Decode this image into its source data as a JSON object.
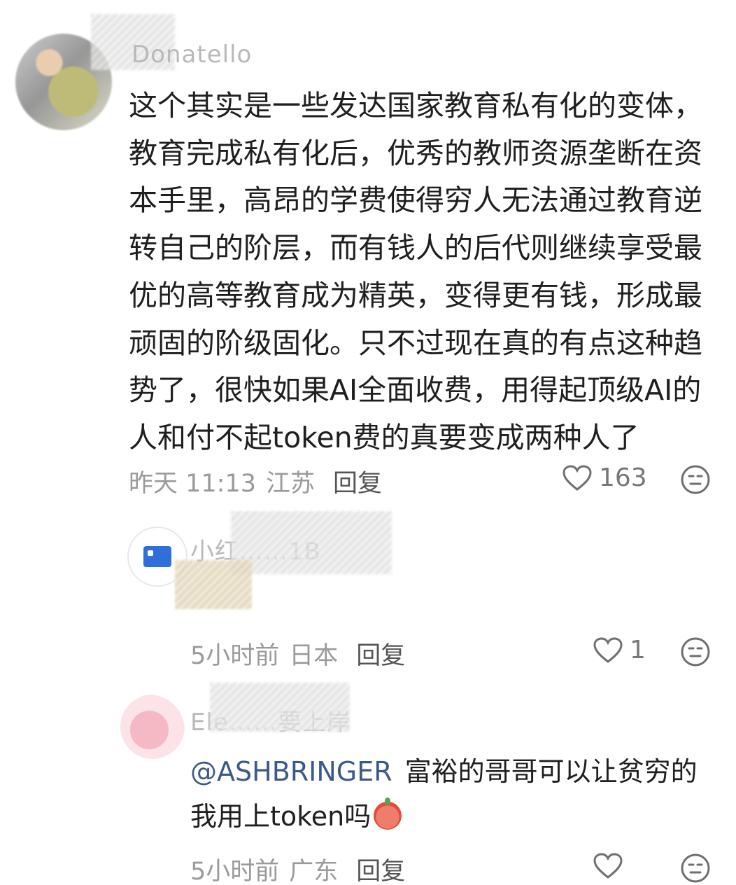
{
  "comment": {
    "username": "Donatello",
    "text_lines": [
      "这个其实是一些发达国家教育私有化的变体，",
      "教育完成私有化后，优秀的教师资源垄断在资",
      "本手里，高昂的学费使得穷人无法通过教育逆",
      "转自己的阶层，而有钱人的后代则继续享受最",
      "优的高等教育成为精英，变得更有钱，形成最",
      "顽固的阶级固化。只不过现在真的有点这种趋",
      "势了，很快如果AI全面收费，用得起顶级AI的",
      "人和付不起token费的真要变成两种人了"
    ],
    "time": "昨天 11:13",
    "location": "江苏",
    "reply_label": "回复",
    "like_count": "163"
  },
  "replies": [
    {
      "username": "小红……1B",
      "time": "5小时前",
      "location": "日本",
      "reply_label": "回复",
      "like_count": "1"
    },
    {
      "username": "Ele……要上岸",
      "mention": "@ASHBRINGER",
      "text_after_mention": "富裕的哥哥可以让贫穷的",
      "text_line2": "我用上token吗",
      "time": "5小时前",
      "location": "广东",
      "reply_label": "回复",
      "like_count": ""
    }
  ],
  "colors": {
    "text": "#1f1f1f",
    "meta": "#9a9a9a",
    "mention": "#3c5a88",
    "username": "#b9b9b9"
  },
  "icons": {
    "like": "heart-outline-icon",
    "dislike": "unhappy-face-icon"
  }
}
